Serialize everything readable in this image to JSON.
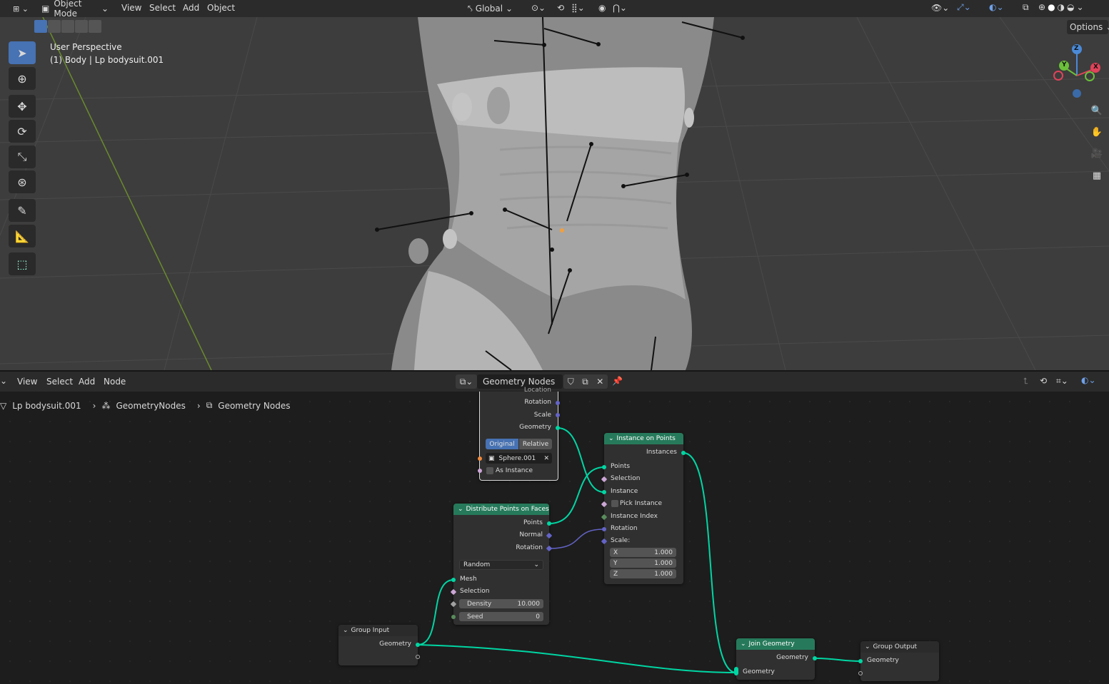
{
  "viewport": {
    "header": {
      "mode": "Object Mode",
      "menus": [
        "View",
        "Select",
        "Add",
        "Object"
      ],
      "transform_orientation": "Global",
      "options_label": "Options"
    },
    "overlay": {
      "view_name": "User Perspective",
      "object_info": "(1) Body | Lp bodysuit.001"
    },
    "gizmo": {
      "z": "Z",
      "y": "Y",
      "x": "X"
    }
  },
  "node_editor": {
    "menus": [
      "View",
      "Select",
      "Add",
      "Node"
    ],
    "tree_name": "Geometry Nodes",
    "breadcrumb": {
      "object": "Lp bodysuit.001",
      "modifier": "GeometryNodes",
      "tree": "Geometry Nodes"
    },
    "object_info_node": {
      "location": "Location",
      "rotation": "Rotation",
      "scale": "Scale",
      "geometry": "Geometry",
      "original": "Original",
      "relative": "Relative",
      "object": "Sphere.001",
      "as_instance": "As Instance"
    },
    "instance_on_points": {
      "title": "Instance on Points",
      "instances": "Instances",
      "points": "Points",
      "selection": "Selection",
      "instance": "Instance",
      "pick_instance": "Pick Instance",
      "instance_index": "Instance Index",
      "rotation": "Rotation",
      "scale": "Scale:",
      "x_label": "X",
      "x_val": "1.000",
      "y_label": "Y",
      "y_val": "1.000",
      "z_label": "Z",
      "z_val": "1.000"
    },
    "distribute": {
      "title": "Distribute Points on Faces",
      "points": "Points",
      "normal": "Normal",
      "rotation": "Rotation",
      "method": "Random",
      "mesh": "Mesh",
      "selection": "Selection",
      "density_label": "Density",
      "density_val": "10.000",
      "seed_label": "Seed",
      "seed_val": "0"
    },
    "group_input": {
      "title": "Group Input",
      "geometry": "Geometry"
    },
    "join_geometry": {
      "title": "Join Geometry",
      "geometry_out": "Geometry",
      "geometry_in": "Geometry"
    },
    "group_output": {
      "title": "Group Output",
      "geometry": "Geometry"
    }
  },
  "colors": {
    "accent": "#4772b3",
    "node_header": "#267a5b",
    "geometry_link": "#00d6a3",
    "vector_link": "#6363c7"
  }
}
